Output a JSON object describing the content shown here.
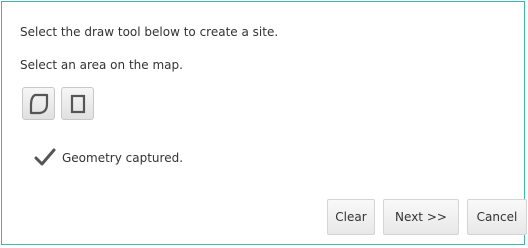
{
  "instructions": {
    "line1": "Select the draw tool below to create a site.",
    "line2": "Select an area on the map."
  },
  "tools": [
    {
      "name": "polygon-icon"
    },
    {
      "name": "rectangle-icon"
    }
  ],
  "status": {
    "icon": "checkmark-icon",
    "text": "Geometry captured."
  },
  "buttons": {
    "clear": "Clear",
    "next": "Next >>",
    "cancel": "Cancel"
  },
  "colors": {
    "border": "#3fb7b0",
    "icon": "#555555"
  }
}
